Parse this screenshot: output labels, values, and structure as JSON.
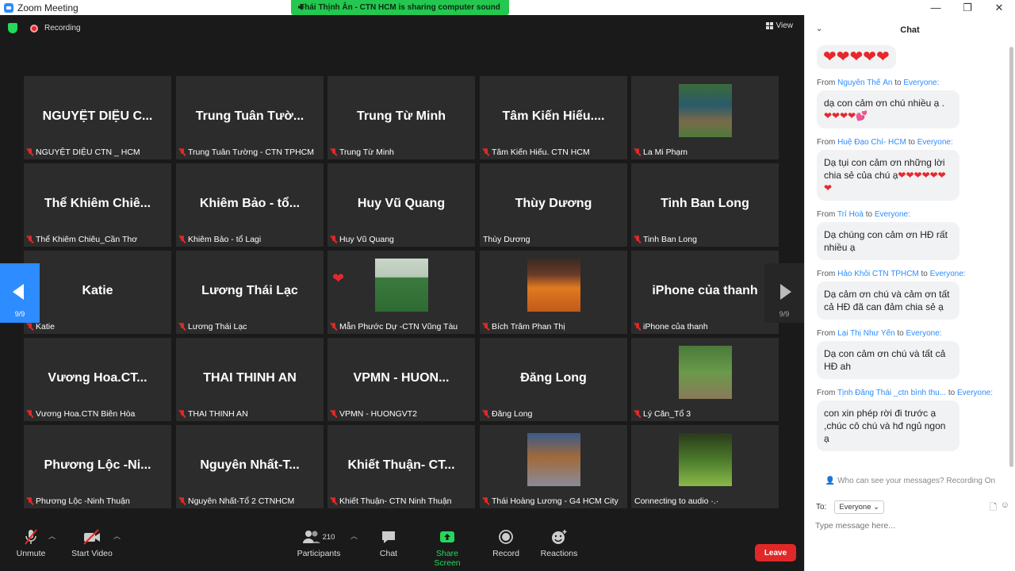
{
  "window": {
    "title": "Zoom Meeting",
    "minimize": "—",
    "maximize": "❐",
    "close": "✕"
  },
  "share_banner": "Thái Thịnh Ân - CTN HCM is sharing computer sound",
  "top": {
    "recording": "Recording",
    "view": "View"
  },
  "pager": {
    "left": "9/9",
    "right": "9/9"
  },
  "tiles": [
    {
      "big": "NGUYỆT DIỆU C...",
      "label": "NGUYỆT DIỆU CTN _ HCM",
      "muted": true
    },
    {
      "big": "Trung Tuân Tườ...",
      "label": "Trung Tuân Tường - CTN TPHCM",
      "muted": true
    },
    {
      "big": "Trung Từ Minh",
      "label": "Trung Từ Minh",
      "muted": true
    },
    {
      "big": "Tâm Kiến Hiếu....",
      "label": "Tâm Kiến Hiếu. CTN HCM",
      "muted": true
    },
    {
      "big": "",
      "label": "La Mi Phạm",
      "muted": true,
      "photo": "garden"
    },
    {
      "big": "Thể Khiêm Chiê...",
      "label": "Thể Khiêm Chiêu_Cần Thơ",
      "muted": true
    },
    {
      "big": "Khiêm Bảo - tổ...",
      "label": "Khiêm Bảo - tổ Lagi",
      "muted": true
    },
    {
      "big": "Huy Vũ Quang",
      "label": "Huy Vũ Quang",
      "muted": true
    },
    {
      "big": "Thùy Dương",
      "label": "Thùy Dương",
      "muted": false
    },
    {
      "big": "Tinh Ban Long",
      "label": "Tinh Ban Long",
      "muted": true
    },
    {
      "big": "Katie",
      "label": "Katie",
      "muted": true
    },
    {
      "big": "Lương Thái Lạc",
      "label": "Lương Thái Lạc",
      "muted": true
    },
    {
      "big": "",
      "label": "Mẫn Phước Dự -CTN Vũng Tàu",
      "muted": true,
      "photo": "woman"
    },
    {
      "big": "",
      "label": "Bích Trâm Phan Thị",
      "muted": true,
      "photo": "woman2"
    },
    {
      "big": "iPhone của thanh",
      "label": "iPhone của thanh",
      "muted": true
    },
    {
      "big": "Vương Hoa.CT...",
      "label": "Vương Hoa.CTN Biên Hòa",
      "muted": true
    },
    {
      "big": "THAI THINH AN",
      "label": "THAI THINH AN",
      "muted": true
    },
    {
      "big": "VPMN - HUON...",
      "label": "VPMN - HUONGVT2",
      "muted": true
    },
    {
      "big": "Đăng Long",
      "label": "Đăng Long",
      "muted": true
    },
    {
      "big": "",
      "label": "Lý Căn_Tổ 3",
      "muted": true,
      "photo": "girl"
    },
    {
      "big": "Phương Lộc -Ni...",
      "label": "Phương Lộc -Ninh Thuận",
      "muted": true
    },
    {
      "big": "Nguyên Nhất-T...",
      "label": "Nguyên Nhất-Tổ 2 CTNHCM",
      "muted": true
    },
    {
      "big": "Khiết Thuận- CT...",
      "label": "Khiết Thuận- CTN Ninh Thuận",
      "muted": true
    },
    {
      "big": "",
      "label": "Thái Hoàng Lương - G4 HCM City",
      "muted": true,
      "photo": "tree"
    },
    {
      "big": "",
      "label": "Connecting to audio ·.·",
      "muted": false,
      "photo": "leaf"
    }
  ],
  "reaction": "❤",
  "toolbar": {
    "unmute": "Unmute",
    "start_video": "Start Video",
    "participants": "Participants",
    "participants_count": "210",
    "chat": "Chat",
    "share_screen": "Share Screen",
    "record": "Record",
    "reactions": "Reactions",
    "leave": "Leave"
  },
  "chat": {
    "title": "Chat",
    "first_hearts": "❤❤❤❤❤",
    "messages": [
      {
        "from": "Nguyễn Thế Ân",
        "to": "Everyone:",
        "text": "dạ con cảm ơn chú nhiều ạ .",
        "hearts": "❤❤❤❤💕"
      },
      {
        "from": "Huệ Đạo Chí-  HCM",
        "to": "Everyone:",
        "text": "Dạ tụi con cảm ơn những lời chia sẻ của chú ạ",
        "hearts": "❤❤❤❤❤❤❤"
      },
      {
        "from": "Trí Hoà",
        "to": "Everyone:",
        "text": "Dạ chúng con cảm ơn HĐ rất nhiều ạ",
        "hearts": ""
      },
      {
        "from": "Hảo Khôi CTN TPHCM",
        "to": "Everyone:",
        "text": "Dạ cảm ơn chú và cảm ơn tất cả HĐ đã can đảm chia sẻ ạ",
        "hearts": ""
      },
      {
        "from": "Lại Thị Như Yến",
        "to": "Everyone:",
        "text": "Dạ con cảm ơn chú và tất cả HĐ ah",
        "hearts": ""
      },
      {
        "from": "Tịnh Đăng Thái _ctn bình thu...",
        "to": "Everyone:",
        "text": "con xin phép rời đi trước ạ ,chúc cô chú và hđ ngủ ngon ạ",
        "hearts": ""
      }
    ],
    "from_word": "From",
    "to_word": "to",
    "who_can_see": "Who can see your messages? Recording On",
    "to_label": "To:",
    "to_value": "Everyone",
    "input_placeholder": "Type message here..."
  }
}
